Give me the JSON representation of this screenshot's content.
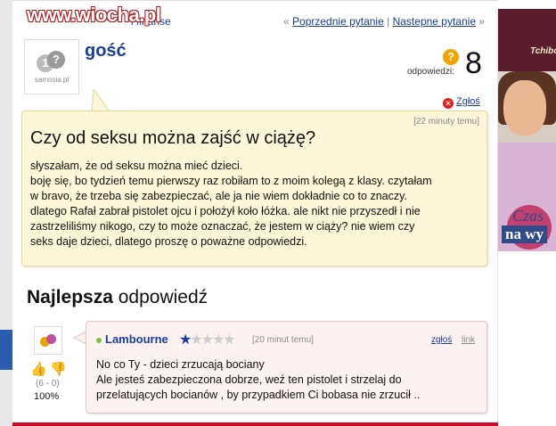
{
  "watermark": "www.wiocha.pl",
  "breadcrumb": {
    "tail": "i finanse"
  },
  "pager": {
    "prev_label": "Poprzednie pytanie",
    "separator": "|",
    "next_label": "Nastepne pytanie",
    "prev_arrow": "«",
    "next_arrow": "»"
  },
  "question": {
    "username": "gość",
    "avatar_brand": "samosia.pl",
    "answers_label": "odpowiedzi:",
    "answers_count": "8",
    "report_label": "Zgłoś",
    "time": "[22 minuty temu]",
    "title": "Czy od seksu można zajść w ciążę?",
    "body": [
      "słyszałam, że od seksu można mieć dzieci.",
      "boję się, bo tydzień temu pierwszy raz robiłam to z moim kolegą z klasy. czytałam",
      "w bravo, że trzeba się zabezpieczać, ale ja nie wiem dokładnie co to znaczy.",
      "dlatego Rafał zabrał pistolet ojcu i położył koło łóżka. ale nikt nie przyszedł i nie",
      "zastrzeliliśmy nikogo, czy to może oznaczać, że jestem w ciąży? nie wiem czy",
      "seks daje dzieci, dlatego proszę o poważne odpowiedzi."
    ]
  },
  "best_answer": {
    "heading_bold": "Najlepsza",
    "heading_rest": "odpowiedź",
    "avatar_brand": "samosia",
    "votes": "(6 - 0)",
    "percent": "100%",
    "username": "Lambourne",
    "rating": 1,
    "rating_max": 5,
    "time": "[20 minut temu]",
    "report_label": "zgłoś",
    "link_label": "link",
    "body": [
      "No co Ty - dzieci zrzucają bociany",
      "Ale jesteś zabezpieczona dobrze, weź ten pistolet i strzelaj do",
      "przelatujących bocianów , by przypadkiem Ci bobasa nie zrzucił .."
    ]
  },
  "ad": {
    "brand": "Tchibo",
    "line1": "Czas",
    "line2": "na wy"
  },
  "colors": {
    "link": "#1a3d9b",
    "question_bg": "#fdf7d7",
    "answer_bg": "#fdf2f2",
    "answers_icon": "#f0a500",
    "accent_red": "#c8102e"
  }
}
